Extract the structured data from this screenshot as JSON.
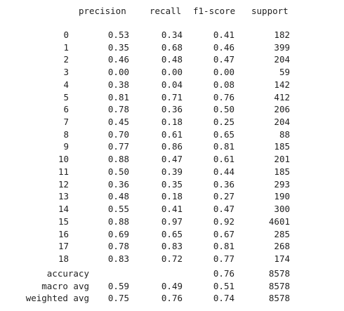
{
  "header": {
    "precision": "precision",
    "recall": "recall",
    "f1": "f1-score",
    "support": "support"
  },
  "rows": [
    {
      "label": "0",
      "precision": "0.53",
      "recall": "0.34",
      "f1": "0.41",
      "support": "182"
    },
    {
      "label": "1",
      "precision": "0.35",
      "recall": "0.68",
      "f1": "0.46",
      "support": "399"
    },
    {
      "label": "2",
      "precision": "0.46",
      "recall": "0.48",
      "f1": "0.47",
      "support": "204"
    },
    {
      "label": "3",
      "precision": "0.00",
      "recall": "0.00",
      "f1": "0.00",
      "support": "59"
    },
    {
      "label": "4",
      "precision": "0.38",
      "recall": "0.04",
      "f1": "0.08",
      "support": "142"
    },
    {
      "label": "5",
      "precision": "0.81",
      "recall": "0.71",
      "f1": "0.76",
      "support": "412"
    },
    {
      "label": "6",
      "precision": "0.78",
      "recall": "0.36",
      "f1": "0.50",
      "support": "206"
    },
    {
      "label": "7",
      "precision": "0.45",
      "recall": "0.18",
      "f1": "0.25",
      "support": "204"
    },
    {
      "label": "8",
      "precision": "0.70",
      "recall": "0.61",
      "f1": "0.65",
      "support": "88"
    },
    {
      "label": "9",
      "precision": "0.77",
      "recall": "0.86",
      "f1": "0.81",
      "support": "185"
    },
    {
      "label": "10",
      "precision": "0.88",
      "recall": "0.47",
      "f1": "0.61",
      "support": "201"
    },
    {
      "label": "11",
      "precision": "0.50",
      "recall": "0.39",
      "f1": "0.44",
      "support": "185"
    },
    {
      "label": "12",
      "precision": "0.36",
      "recall": "0.35",
      "f1": "0.36",
      "support": "293"
    },
    {
      "label": "13",
      "precision": "0.48",
      "recall": "0.18",
      "f1": "0.27",
      "support": "190"
    },
    {
      "label": "14",
      "precision": "0.55",
      "recall": "0.41",
      "f1": "0.47",
      "support": "300"
    },
    {
      "label": "15",
      "precision": "0.88",
      "recall": "0.97",
      "f1": "0.92",
      "support": "4601"
    },
    {
      "label": "16",
      "precision": "0.69",
      "recall": "0.65",
      "f1": "0.67",
      "support": "285"
    },
    {
      "label": "17",
      "precision": "0.78",
      "recall": "0.83",
      "f1": "0.81",
      "support": "268"
    },
    {
      "label": "18",
      "precision": "0.83",
      "recall": "0.72",
      "f1": "0.77",
      "support": "174"
    }
  ],
  "summary": [
    {
      "label": "accuracy",
      "precision": "",
      "recall": "",
      "f1": "0.76",
      "support": "8578"
    },
    {
      "label": "macro avg",
      "precision": "0.59",
      "recall": "0.49",
      "f1": "0.51",
      "support": "8578"
    },
    {
      "label": "weighted avg",
      "precision": "0.75",
      "recall": "0.76",
      "f1": "0.74",
      "support": "8578"
    }
  ]
}
